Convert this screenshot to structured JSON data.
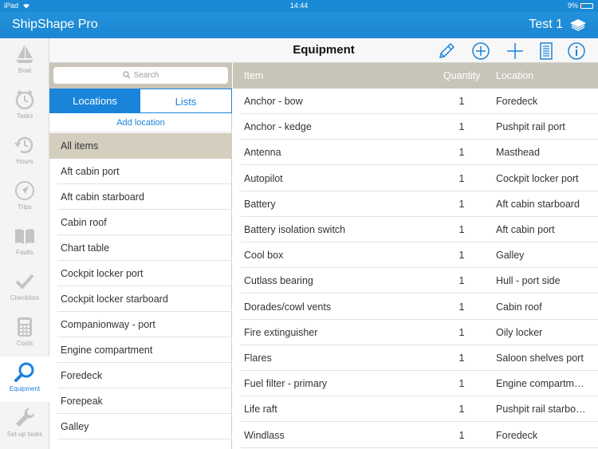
{
  "status_bar": {
    "device": "iPad",
    "time": "14:44",
    "battery": "9%",
    "battery_level": 0.09
  },
  "nav": {
    "app_title": "ShipShape Pro",
    "boat_name": "Test 1"
  },
  "tabbar": {
    "items": [
      {
        "label": "Boat",
        "icon": "sailboat-icon"
      },
      {
        "label": "Tasks",
        "icon": "clock-icon"
      },
      {
        "label": "Hours",
        "icon": "history-icon"
      },
      {
        "label": "Trips",
        "icon": "navigation-icon"
      },
      {
        "label": "Faults",
        "icon": "book-icon"
      },
      {
        "label": "Checklists",
        "icon": "checkmark-icon"
      },
      {
        "label": "Costs",
        "icon": "calculator-icon"
      },
      {
        "label": "Equipment",
        "icon": "magnifier-icon"
      },
      {
        "label": "Set-up tasks",
        "icon": "wrench-icon"
      }
    ],
    "active": "Equipment"
  },
  "toolbar": {
    "title": "Equipment",
    "icons": [
      "pencil-icon",
      "add-circle-icon",
      "plus-icon",
      "document-icon",
      "info-icon"
    ],
    "accent": "#1a84db"
  },
  "search": {
    "placeholder": "Search"
  },
  "segments": {
    "locations": "Locations",
    "lists": "Lists",
    "selected": "Locations"
  },
  "add_location": "Add location",
  "locations": [
    "All items",
    "Aft cabin port",
    "Aft cabin starboard",
    "Cabin roof",
    "Chart table",
    "Cockpit locker port",
    "Cockpit locker starboard",
    "Companionway - port",
    "Engine compartment",
    "Foredeck",
    "Forepeak",
    "Galley"
  ],
  "selected_location": "All items",
  "table": {
    "headers": {
      "item": "Item",
      "quantity": "Quantity",
      "location": "Location"
    },
    "rows": [
      {
        "item": "Anchor - bow",
        "qty": "1",
        "location": "Foredeck"
      },
      {
        "item": "Anchor - kedge",
        "qty": "1",
        "location": "Pushpit rail port"
      },
      {
        "item": "Antenna",
        "qty": "1",
        "location": "Masthead"
      },
      {
        "item": "Autopilot",
        "qty": "1",
        "location": "Cockpit locker port"
      },
      {
        "item": "Battery",
        "qty": "1",
        "location": "Aft cabin starboard"
      },
      {
        "item": "Battery isolation switch",
        "qty": "1",
        "location": "Aft cabin port"
      },
      {
        "item": "Cool box",
        "qty": "1",
        "location": "Galley"
      },
      {
        "item": "Cutlass bearing",
        "qty": "1",
        "location": "Hull - port side"
      },
      {
        "item": "Dorades/cowl vents",
        "qty": "1",
        "location": "Cabin roof"
      },
      {
        "item": "Fire extinguisher",
        "qty": "1",
        "location": "Oily locker"
      },
      {
        "item": "Flares",
        "qty": "1",
        "location": "Saloon shelves port"
      },
      {
        "item": "Fuel filter - primary",
        "qty": "1",
        "location": "Engine compartm…"
      },
      {
        "item": "Life raft",
        "qty": "1",
        "location": "Pushpit rail starbo…"
      },
      {
        "item": "Windlass",
        "qty": "1",
        "location": "Foredeck"
      }
    ]
  }
}
